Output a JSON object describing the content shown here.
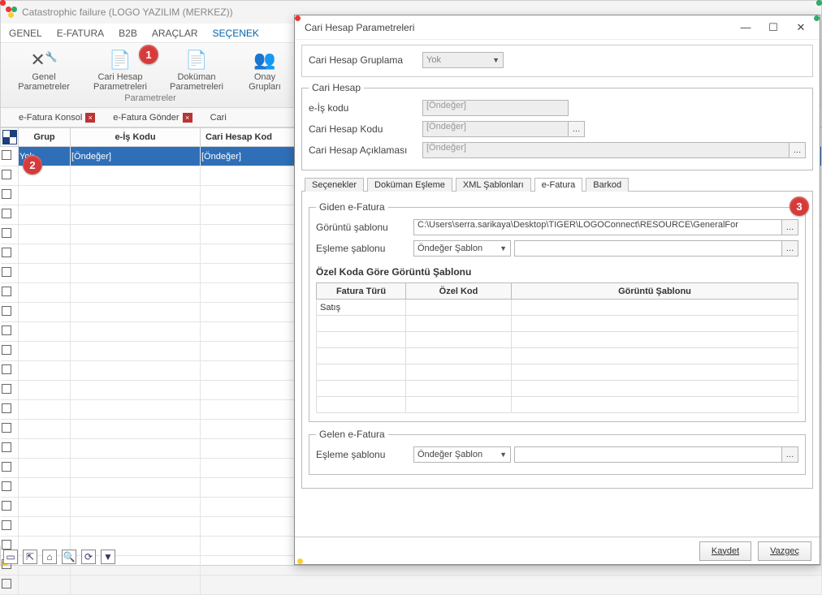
{
  "mainWindow": {
    "title": "Catastrophic failure (LOGO YAZILIM (MERKEZ))"
  },
  "menubar": {
    "items": [
      "GENEL",
      "E-FATURA",
      "B2B",
      "ARAÇLAR",
      "SEÇENEK"
    ]
  },
  "ribbon": {
    "buttons": [
      {
        "line1": "Genel",
        "line2": "Parametreler"
      },
      {
        "line1": "Cari Hesap",
        "line2": "Parametreleri"
      },
      {
        "line1": "Doküman",
        "line2": "Parametreleri"
      },
      {
        "line1": "Onay",
        "line2": "Grupları"
      }
    ],
    "groupCaption": "Parametreler"
  },
  "badges": {
    "one": "1",
    "two": "2",
    "three": "3"
  },
  "docTabs": {
    "items": [
      "e-Fatura Konsol",
      "e-Fatura Gönder",
      "Cari"
    ]
  },
  "grid": {
    "headers": [
      "Grup",
      "e-İş Kodu",
      "Cari Hesap Kod"
    ],
    "firstRow": {
      "grup": "Yok",
      "eis": "[Öndeğer]",
      "chk": "[Öndeğer]"
    }
  },
  "dialog": {
    "title": "Cari Hesap Parametreleri",
    "gruplamaLabel": "Cari Hesap Gruplama",
    "gruplamaValue": "Yok",
    "cariHesapLegend": "Cari Hesap",
    "eisLabel": "e-İş kodu",
    "eisPlaceholder": "[Öndeğer]",
    "chkLabel": "Cari Hesap Kodu",
    "chkPlaceholder": "[Öndeğer]",
    "chaLabel": "Cari Hesap Açıklaması",
    "chaPlaceholder": "[Öndeğer]",
    "innerTabs": [
      "Seçenekler",
      "Doküman Eşleme",
      "XML Şablonları",
      "e-Fatura",
      "Barkod"
    ],
    "gidenLegend": "Giden e-Fatura",
    "goruntuLabel": "Görüntü şablonu",
    "goruntuValue": "C:\\Users\\serra.sarikaya\\Desktop\\TIGER\\LOGOConnect\\RESOURCE\\GeneralFor",
    "eslemeLabel": "Eşleme şablonu",
    "eslemeValue": "Öndeğer Şablon",
    "ozelTitle": "Özel Koda Göre Görüntü Şablonu",
    "ozelHeaders": [
      "Fatura Türü",
      "Özel Kod",
      "Görüntü Şablonu"
    ],
    "ozelFirst": "Satış",
    "gelenLegend": "Gelen e-Fatura",
    "gelenEslemeLabel": "Eşleme şablonu",
    "gelenEslemeValue": "Öndeğer Şablon",
    "saveLabel": "Kaydet",
    "cancelLabel": "Vazgeç"
  }
}
